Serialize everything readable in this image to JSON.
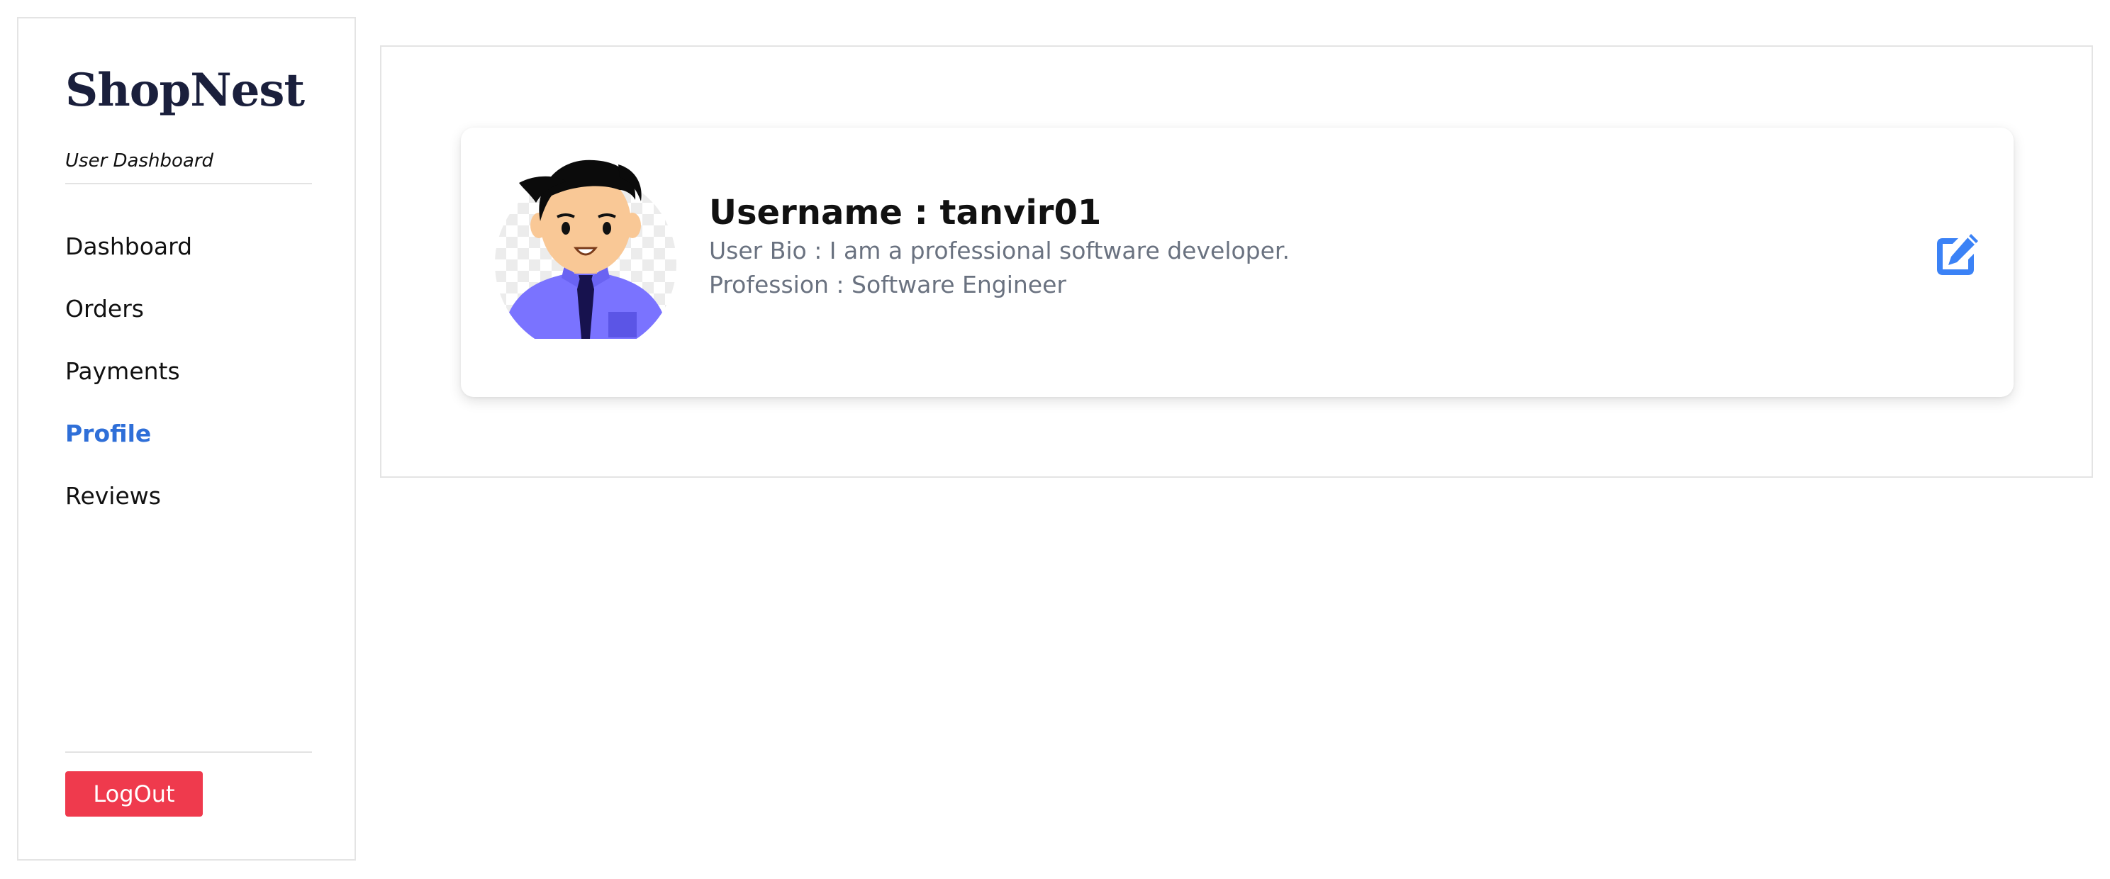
{
  "sidebar": {
    "brand": "ShopNest",
    "subtitle": "User Dashboard",
    "items": [
      {
        "label": "Dashboard",
        "active": false
      },
      {
        "label": "Orders",
        "active": false
      },
      {
        "label": "Payments",
        "active": false
      },
      {
        "label": "Profile",
        "active": true
      },
      {
        "label": "Reviews",
        "active": false
      }
    ],
    "logout_label": "LogOut"
  },
  "profile": {
    "username": "Username : tanvir01",
    "bio": "User Bio : I am a professional software developer.",
    "profession": "Profession : Software Engineer",
    "avatar_icon": "user-avatar",
    "edit_icon": "edit-icon"
  },
  "colors": {
    "accent": "#2f6fd8",
    "logout": "#ef3a4d",
    "brand": "#1a1f3c",
    "edit": "#3b82f6"
  }
}
